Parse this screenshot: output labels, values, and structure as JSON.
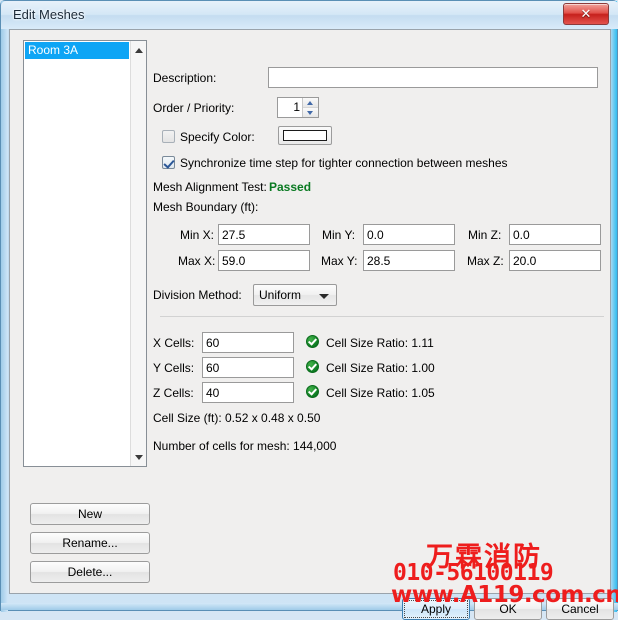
{
  "window": {
    "title": "Edit Meshes",
    "close_label": "✕"
  },
  "mesh_list": {
    "items": [
      {
        "label": "Room 3A",
        "selected": true
      }
    ],
    "scroll_up_icon": "caret-up-icon",
    "scroll_down_icon": "caret-down-icon"
  },
  "list_buttons": {
    "new": "New",
    "rename": "Rename...",
    "delete": "Delete..."
  },
  "form": {
    "description_label": "Description:",
    "description_value": "",
    "order_label": "Order / Priority:",
    "order_value": "1",
    "specify_color_label": "Specify Color:",
    "specify_color_checked": false,
    "color_swatch_hex": "#ffffff",
    "sync_label": "Synchronize time step for tighter connection between meshes",
    "sync_checked": true,
    "alignment_label": "Mesh Alignment Test:",
    "alignment_value": "Passed",
    "alignment_color": "#0a7a22",
    "boundary_label": "Mesh Boundary (ft):",
    "boundary": {
      "min_x_label": "Min X:",
      "min_x_value": "27.5",
      "min_y_label": "Min Y:",
      "min_y_value": "0.0",
      "min_z_label": "Min Z:",
      "min_z_value": "0.0",
      "max_x_label": "Max X:",
      "max_x_value": "59.0",
      "max_y_label": "Max Y:",
      "max_y_value": "28.5",
      "max_z_label": "Max Z:",
      "max_z_value": "20.0"
    },
    "division_method_label": "Division Method:",
    "division_method_value": "Uniform",
    "division_method_options": [
      "Uniform"
    ],
    "cells": {
      "x_label": "X Cells:",
      "x_value": "60",
      "x_ratio": "Cell Size Ratio: 1.11",
      "y_label": "Y Cells:",
      "y_value": "60",
      "y_ratio": "Cell Size Ratio: 1.00",
      "z_label": "Z Cells:",
      "z_value": "40",
      "z_ratio": "Cell Size Ratio: 1.05"
    },
    "cell_size_text": "Cell Size (ft): 0.52 x 0.48 x 0.50",
    "num_cells_text": "Number of cells for mesh: 144,000"
  },
  "dialog_buttons": {
    "apply": "Apply",
    "ok": "OK",
    "cancel": "Cancel"
  },
  "watermark": {
    "company": "万霖消防",
    "phone": "010-56100119",
    "url": "www.A119.com.cn",
    "color": "#ee1d1d"
  }
}
